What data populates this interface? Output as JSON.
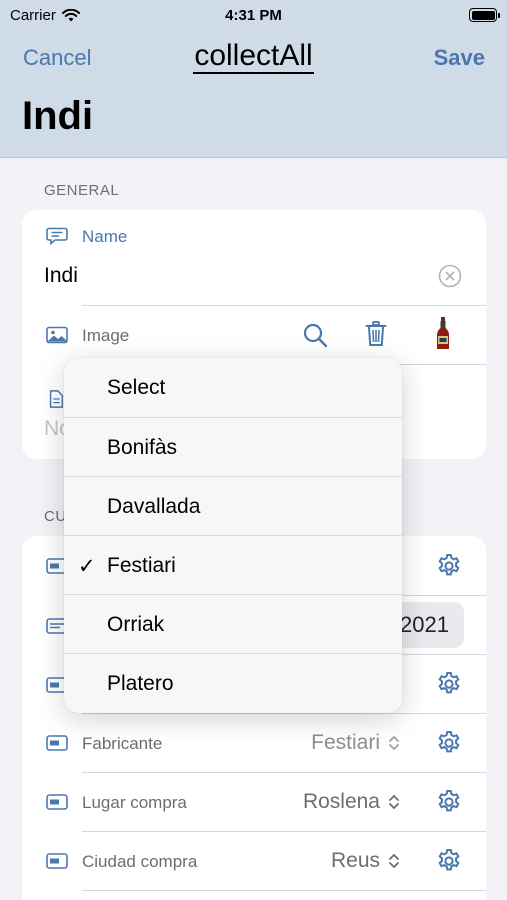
{
  "status_bar": {
    "carrier": "Carrier",
    "time": "4:31 PM"
  },
  "nav": {
    "cancel": "Cancel",
    "brand": "collectAll",
    "save": "Save",
    "title": "Indi"
  },
  "general": {
    "header": "GENERAL",
    "name_label": "Name",
    "name_value": "Indi",
    "image_label": "Image",
    "notes_placeholder_partial": "No"
  },
  "custom": {
    "header_partial": "CU",
    "year_value": "2021",
    "rows": [
      {
        "label": "Fabricante",
        "value": "Festiari"
      },
      {
        "label": "Lugar compra",
        "value": "Roslena"
      },
      {
        "label": "Ciudad compra",
        "value": "Reus"
      }
    ]
  },
  "menu": {
    "items": [
      "Select",
      "Bonifàs",
      "Davallada",
      "Festiari",
      "Orriak",
      "Platero"
    ],
    "selected": "Festiari",
    "check": "✓"
  },
  "colors": {
    "accent": "#4a78ad",
    "nav_bg": "#cfdbe7"
  }
}
